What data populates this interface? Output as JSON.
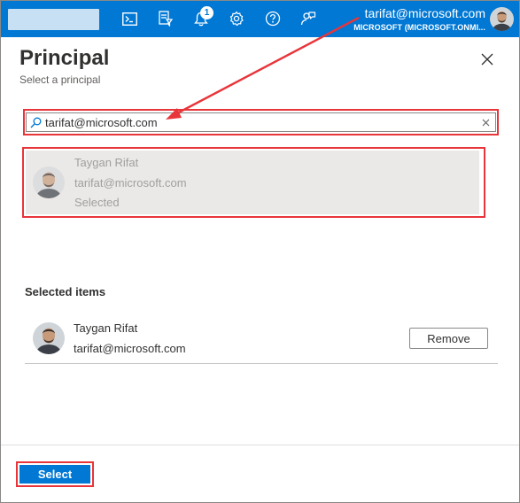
{
  "topbar": {
    "notification_count": "1",
    "account_name": "tarifat@microsoft.com",
    "account_tenant": "MICROSOFT (MICROSOFT.ONMI...",
    "icons": [
      "cloud-shell-icon",
      "directory-filter-icon",
      "bell-icon",
      "gear-icon",
      "help-icon",
      "feedback-icon"
    ]
  },
  "panel": {
    "title": "Principal",
    "subtitle": "Select a principal"
  },
  "search": {
    "value": "tarifat@microsoft.com"
  },
  "result": {
    "name": "Taygan Rifat",
    "email": "tarifat@microsoft.com",
    "status": "Selected"
  },
  "selected": {
    "heading": "Selected items",
    "items": [
      {
        "name": "Taygan Rifat",
        "email": "tarifat@microsoft.com",
        "remove_label": "Remove"
      }
    ]
  },
  "footer": {
    "select_label": "Select"
  },
  "colors": {
    "topbar": "#0078d4",
    "highlight": "#e8353a",
    "selected_card": "#ebe9e7"
  }
}
